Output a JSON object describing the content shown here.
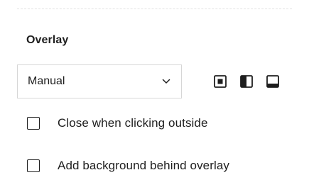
{
  "overlay": {
    "title": "Overlay",
    "mode_select": {
      "value": "Manual",
      "icon": "chevron-down-icon"
    },
    "position_options": [
      {
        "name": "overlay-center-icon"
      },
      {
        "name": "overlay-left-half-icon"
      },
      {
        "name": "overlay-bottom-icon"
      }
    ],
    "options": [
      {
        "label": "Close when clicking outside",
        "checked": false
      },
      {
        "label": "Add background behind overlay",
        "checked": false
      }
    ]
  }
}
